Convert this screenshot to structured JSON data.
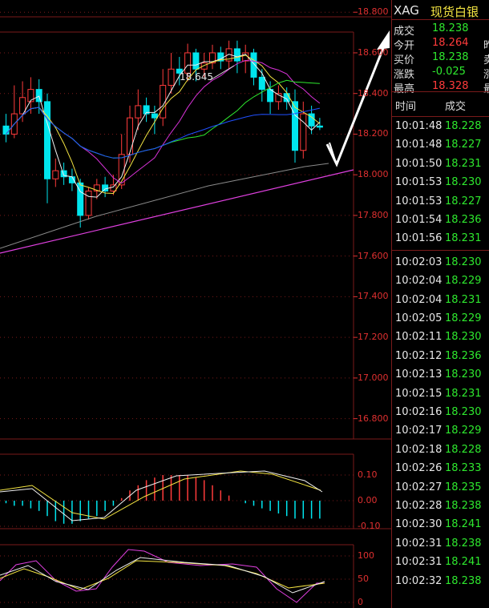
{
  "instrument": {
    "symbol": "XAG",
    "name": "现货白银"
  },
  "quote": [
    {
      "label": "成交",
      "value": "18.238",
      "color": "#2ee82e",
      "right": ""
    },
    {
      "label": "今开",
      "value": "18.264",
      "color": "#ff3b3b",
      "right": "昨"
    },
    {
      "label": "买价",
      "value": "18.238",
      "color": "#2ee82e",
      "right": "卖"
    },
    {
      "label": "涨跌",
      "value": "-0.025",
      "color": "#2ee82e",
      "right": "涨"
    },
    {
      "label": "最高",
      "value": "18.328",
      "color": "#ff3b3b",
      "right": "最"
    }
  ],
  "ticks_header": {
    "time": "时间",
    "price": "成交"
  },
  "ticks": [
    {
      "time": "10:01:48",
      "price": "18.228"
    },
    {
      "time": "10:01:48",
      "price": "18.227"
    },
    {
      "time": "10:01:50",
      "price": "18.231"
    },
    {
      "time": "10:01:53",
      "price": "18.230"
    },
    {
      "time": "10:01:53",
      "price": "18.227"
    },
    {
      "time": "10:01:54",
      "price": "18.236"
    },
    {
      "time": "10:01:56",
      "price": "18.231"
    },
    {
      "time": "10:02:03",
      "price": "18.230"
    },
    {
      "time": "10:02:04",
      "price": "18.229"
    },
    {
      "time": "10:02:04",
      "price": "18.231"
    },
    {
      "time": "10:02:05",
      "price": "18.229"
    },
    {
      "time": "10:02:11",
      "price": "18.230"
    },
    {
      "time": "10:02:12",
      "price": "18.236"
    },
    {
      "time": "10:02:13",
      "price": "18.230"
    },
    {
      "time": "10:02:15",
      "price": "18.231"
    },
    {
      "time": "10:02:16",
      "price": "18.230"
    },
    {
      "time": "10:02:17",
      "price": "18.229"
    },
    {
      "time": "10:02:18",
      "price": "18.228"
    },
    {
      "time": "10:02:26",
      "price": "18.233"
    },
    {
      "time": "10:02:27",
      "price": "18.235"
    },
    {
      "time": "10:02:28",
      "price": "18.238"
    },
    {
      "time": "10:02:30",
      "price": "18.241"
    },
    {
      "time": "10:02:31",
      "price": "18.238"
    },
    {
      "time": "10:02:31",
      "price": "18.241"
    },
    {
      "time": "10:02:32",
      "price": "18.238"
    }
  ],
  "colors": {
    "up": "#ff3b3b",
    "down": "#00e5ee",
    "grid": "#7a1a1a",
    "price_green": "#2ee82e"
  },
  "chart_data": {
    "type": "candlestick",
    "price_axis": {
      "ticks": [
        "18.800",
        "18.600",
        "18.400",
        "18.200",
        "18.000",
        "17.800",
        "17.600",
        "17.400",
        "17.200",
        "17.000",
        "16.800"
      ],
      "range": [
        16.7,
        18.86
      ]
    },
    "high_annotation": "18.645",
    "candles": [
      {
        "o": 18.24,
        "c": 18.2,
        "h": 18.3,
        "l": 18.16
      },
      {
        "o": 18.2,
        "c": 18.3,
        "h": 18.44,
        "l": 18.18
      },
      {
        "o": 18.3,
        "c": 18.38,
        "h": 18.46,
        "l": 18.26
      },
      {
        "o": 18.36,
        "c": 18.42,
        "h": 18.48,
        "l": 18.3
      },
      {
        "o": 18.42,
        "c": 18.36,
        "h": 18.47,
        "l": 18.3
      },
      {
        "o": 18.36,
        "c": 17.98,
        "h": 18.4,
        "l": 17.86
      },
      {
        "o": 17.98,
        "c": 18.02,
        "h": 18.08,
        "l": 17.94
      },
      {
        "o": 18.02,
        "c": 17.99,
        "h": 18.06,
        "l": 17.95
      },
      {
        "o": 17.99,
        "c": 17.96,
        "h": 18.03,
        "l": 17.92
      },
      {
        "o": 17.96,
        "c": 17.8,
        "h": 17.98,
        "l": 17.74
      },
      {
        "o": 17.8,
        "c": 17.92,
        "h": 17.94,
        "l": 17.78
      },
      {
        "o": 17.92,
        "c": 17.95,
        "h": 17.98,
        "l": 17.88
      },
      {
        "o": 17.95,
        "c": 17.92,
        "h": 17.99,
        "l": 17.89
      },
      {
        "o": 17.92,
        "c": 17.95,
        "h": 18.0,
        "l": 17.9
      },
      {
        "o": 17.95,
        "c": 18.1,
        "h": 18.2,
        "l": 17.93
      },
      {
        "o": 18.1,
        "c": 18.28,
        "h": 18.34,
        "l": 18.06
      },
      {
        "o": 18.28,
        "c": 18.34,
        "h": 18.42,
        "l": 18.22
      },
      {
        "o": 18.34,
        "c": 18.3,
        "h": 18.38,
        "l": 18.26
      },
      {
        "o": 18.3,
        "c": 18.28,
        "h": 18.34,
        "l": 18.2
      },
      {
        "o": 18.28,
        "c": 18.44,
        "h": 18.52,
        "l": 18.24
      },
      {
        "o": 18.44,
        "c": 18.52,
        "h": 18.6,
        "l": 18.4
      },
      {
        "o": 18.52,
        "c": 18.5,
        "h": 18.58,
        "l": 18.44
      },
      {
        "o": 18.5,
        "c": 18.6,
        "h": 18.645,
        "l": 18.46
      },
      {
        "o": 18.6,
        "c": 18.52,
        "h": 18.62,
        "l": 18.46
      },
      {
        "o": 18.52,
        "c": 18.55,
        "h": 18.6,
        "l": 18.48
      },
      {
        "o": 18.55,
        "c": 18.6,
        "h": 18.64,
        "l": 18.52
      },
      {
        "o": 18.6,
        "c": 18.56,
        "h": 18.63,
        "l": 18.52
      },
      {
        "o": 18.56,
        "c": 18.62,
        "h": 18.66,
        "l": 18.52
      },
      {
        "o": 18.62,
        "c": 18.56,
        "h": 18.66,
        "l": 18.5
      },
      {
        "o": 18.56,
        "c": 18.6,
        "h": 18.64,
        "l": 18.5
      },
      {
        "o": 18.6,
        "c": 18.48,
        "h": 18.62,
        "l": 18.44
      },
      {
        "o": 18.48,
        "c": 18.42,
        "h": 18.52,
        "l": 18.36
      },
      {
        "o": 18.42,
        "c": 18.36,
        "h": 18.46,
        "l": 18.3
      },
      {
        "o": 18.36,
        "c": 18.4,
        "h": 18.44,
        "l": 18.32
      },
      {
        "o": 18.4,
        "c": 18.36,
        "h": 18.43,
        "l": 18.32
      },
      {
        "o": 18.36,
        "c": 18.12,
        "h": 18.42,
        "l": 18.06
      },
      {
        "o": 18.12,
        "c": 18.3,
        "h": 18.36,
        "l": 18.08
      },
      {
        "o": 18.3,
        "c": 18.24,
        "h": 18.34,
        "l": 18.2
      },
      {
        "o": 18.24,
        "c": 18.238,
        "h": 18.28,
        "l": 18.22
      }
    ]
  }
}
